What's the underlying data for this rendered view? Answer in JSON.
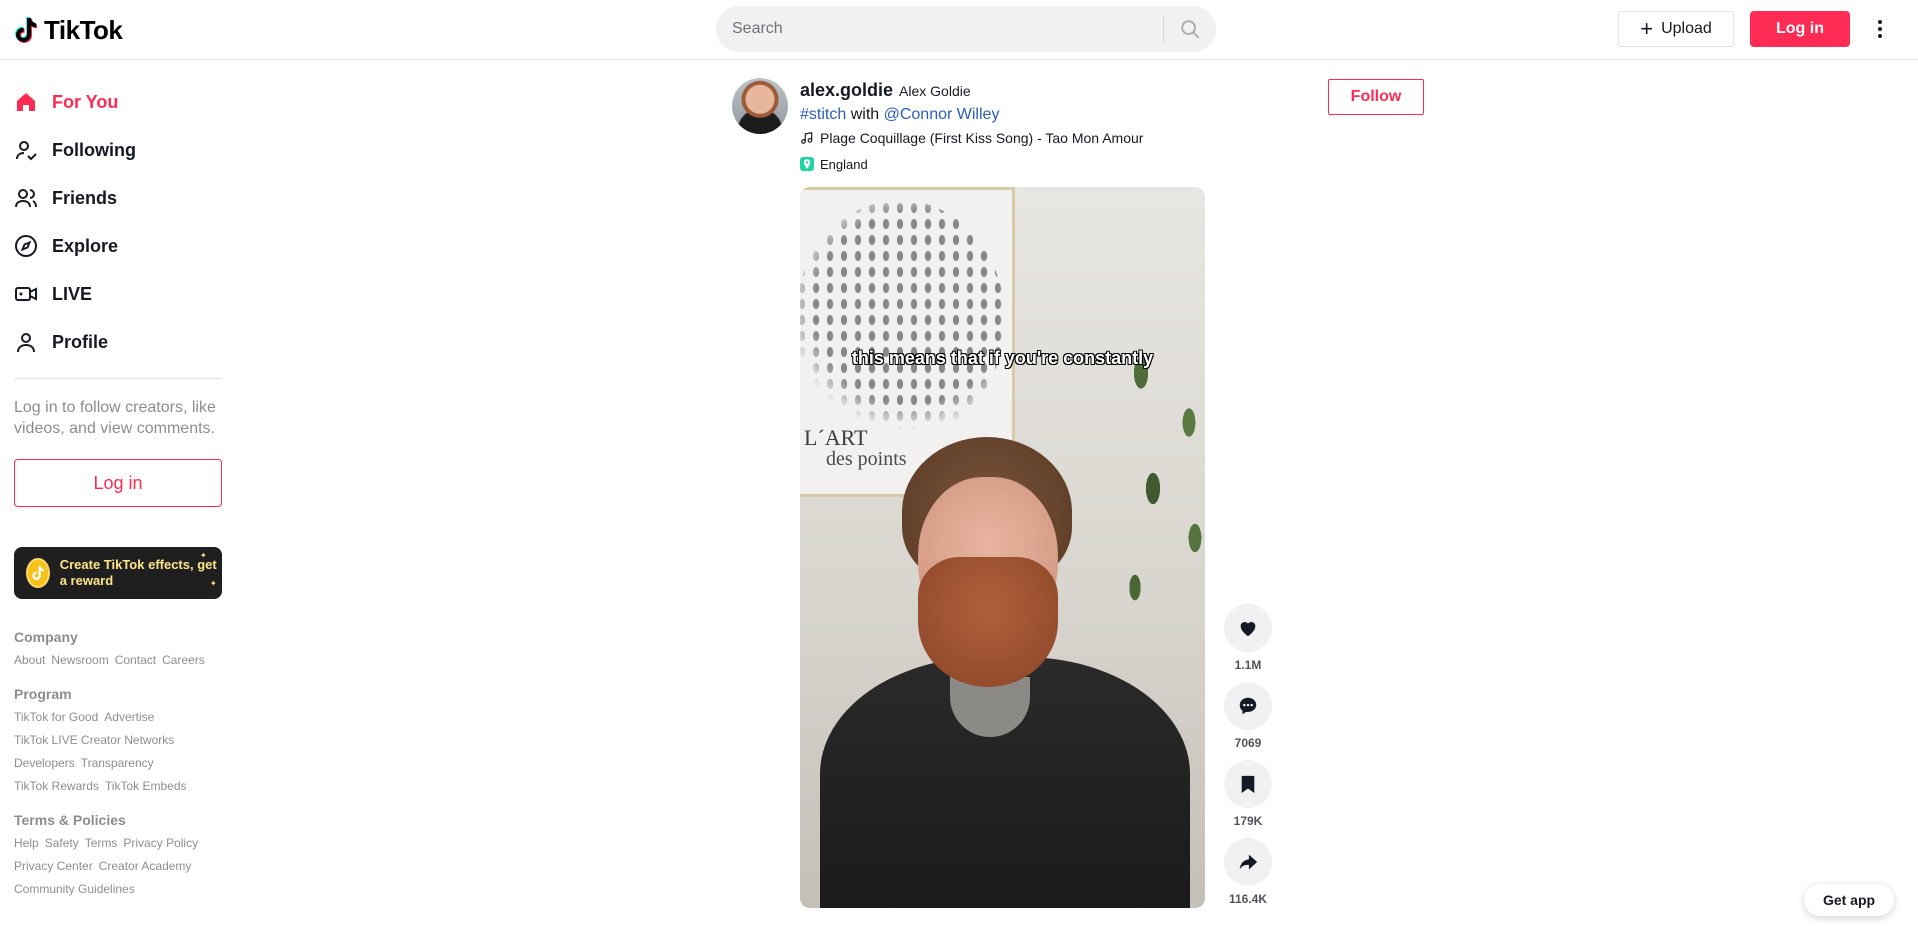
{
  "header": {
    "logo_text": "TikTok",
    "search_placeholder": "Search",
    "upload_label": "Upload",
    "login_label": "Log in"
  },
  "sidebar": {
    "nav": [
      {
        "label": "For You",
        "icon": "home-icon",
        "active": true
      },
      {
        "label": "Following",
        "icon": "following-icon",
        "active": false
      },
      {
        "label": "Friends",
        "icon": "friends-icon",
        "active": false
      },
      {
        "label": "Explore",
        "icon": "compass-icon",
        "active": false
      },
      {
        "label": "LIVE",
        "icon": "live-icon",
        "active": false
      },
      {
        "label": "Profile",
        "icon": "profile-icon",
        "active": false
      }
    ],
    "login_prompt": "Log in to follow creators, like videos, and view comments.",
    "login_label": "Log in",
    "effects_banner": "Create TikTok effects, get a reward",
    "footer": {
      "company_title": "Company",
      "company_links": [
        "About",
        "Newsroom",
        "Contact",
        "Careers"
      ],
      "program_title": "Program",
      "program_links": [
        "TikTok for Good",
        "Advertise",
        "TikTok LIVE Creator Networks",
        "Developers",
        "Transparency",
        "TikTok Rewards",
        "TikTok Embeds"
      ],
      "terms_title": "Terms & Policies",
      "terms_links": [
        "Help",
        "Safety",
        "Terms",
        "Privacy Policy",
        "Privacy Center",
        "Creator Academy",
        "Community Guidelines"
      ]
    }
  },
  "post": {
    "username": "alex.goldie",
    "nickname": "Alex Goldie",
    "caption_tag": "#stitch",
    "caption_with": "with",
    "caption_mention": "@Connor Willey",
    "music": "Plage Coquillage (First Kiss Song) - Tao Mon Amour",
    "location": "England",
    "follow_label": "Follow",
    "subtitle": "this means that if you're constantly",
    "poster_title": "L´ART",
    "poster_subtitle": "des points"
  },
  "actions": [
    {
      "name": "like",
      "icon": "heart-icon",
      "count": "1.1M"
    },
    {
      "name": "comment",
      "icon": "comment-icon",
      "count": "7069"
    },
    {
      "name": "bookmark",
      "icon": "bookmark-icon",
      "count": "179K"
    },
    {
      "name": "share",
      "icon": "share-icon",
      "count": "116.4K"
    }
  ],
  "get_app_label": "Get app",
  "colors": {
    "accent": "#fe2c55",
    "link": "#2b5db9",
    "text": "#161823"
  }
}
